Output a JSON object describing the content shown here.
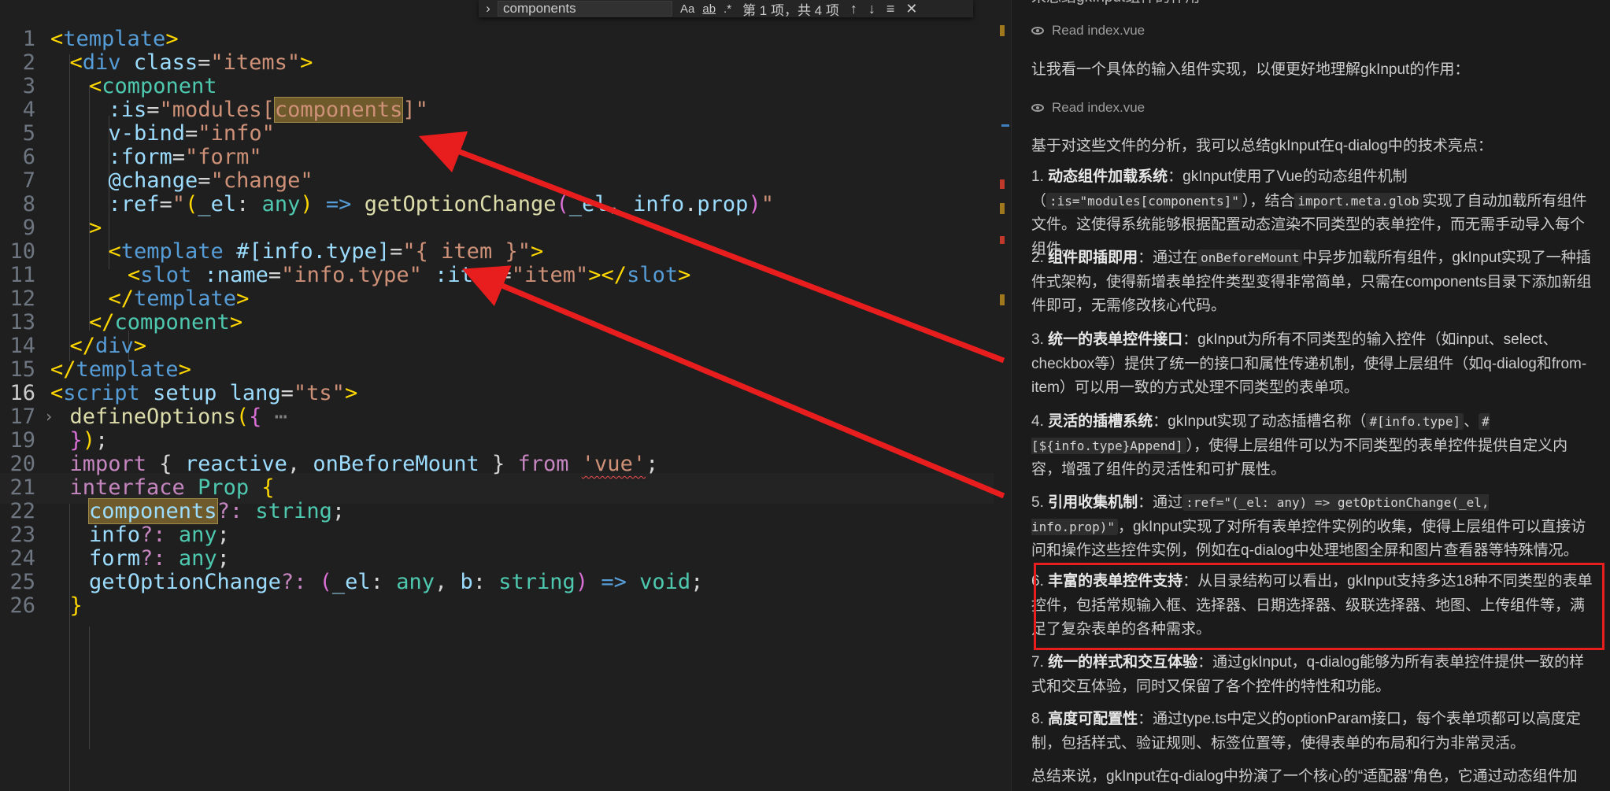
{
  "find_widget": {
    "query": "components",
    "match_case_label": "Aa",
    "whole_word_label": "ab",
    "regex_label": ".*",
    "result_count": "第 1 项，共 4 项",
    "prev_icon": "arrow-up-icon",
    "next_icon": "arrow-down-icon",
    "selection_icon": "find-in-selection-icon",
    "close_icon": "close-icon"
  },
  "editor": {
    "line_numbers": [
      "1",
      "2",
      "3",
      "4",
      "5",
      "6",
      "7",
      "8",
      "9",
      "10",
      "11",
      "12",
      "13",
      "14",
      "15",
      "16",
      "17",
      "19",
      "20",
      "21",
      "22",
      "23",
      "24",
      "25",
      "26"
    ],
    "current_line": "16",
    "lines": {
      "l1": [
        "<",
        "template",
        ">"
      ],
      "l2": [
        "<",
        "div",
        " class",
        "=",
        "\"items\"",
        ">"
      ],
      "l3": [
        "<",
        "component"
      ],
      "l4": [
        ":is",
        "=",
        "\"modules[",
        "components",
        "]\""
      ],
      "l5": [
        "v-bind",
        "=",
        "\"info\""
      ],
      "l6": [
        ":form",
        "=",
        "\"form\""
      ],
      "l7": [
        "@change",
        "=",
        "\"change\""
      ],
      "l8": [
        ":ref",
        "=",
        "\"",
        "(",
        "_el",
        ": ",
        "any",
        ")",
        " => ",
        "getOptionChange",
        "(",
        "_el",
        ", ",
        "info",
        ".",
        "prop",
        ")",
        "\""
      ],
      "l9": [
        ">"
      ],
      "l10": [
        "<",
        "template",
        " #[info.type]",
        "=",
        "\"{ item }\"",
        ">"
      ],
      "l11": [
        "<",
        "slot",
        " :name",
        "=",
        "\"info.type\"",
        " :item",
        "=",
        "\"item\"",
        "></",
        "slot",
        ">"
      ],
      "l12": [
        "</",
        "template",
        ">"
      ],
      "l13": [
        "</",
        "component",
        ">"
      ],
      "l14": [
        "</",
        "div",
        ">"
      ],
      "l15": [
        "</",
        "template",
        ">"
      ],
      "l16": [
        "<",
        "script",
        " setup",
        " lang",
        "=",
        "\"ts\"",
        ">"
      ],
      "l17": [
        "defineOptions",
        "(",
        "{",
        " ⋯"
      ],
      "l19": [
        "}",
        ")",
        ";"
      ],
      "l20": [
        "import",
        " { ",
        "reactive",
        ", ",
        "onBeforeMount",
        " } ",
        "from",
        " ",
        "'vue'",
        ";"
      ],
      "l21": [
        "interface",
        " ",
        "Prop",
        " ",
        "{"
      ],
      "l22": [
        "components",
        "?: ",
        "string",
        ";"
      ],
      "l23": [
        "info",
        "?: ",
        "any",
        ";"
      ],
      "l24": [
        "form",
        "?: ",
        "any",
        ";"
      ],
      "l25": [
        "getOptionChange",
        "?: ",
        "(",
        "_el",
        ": ",
        "any",
        ", ",
        "b",
        ": ",
        "string",
        ")",
        " => ",
        "void",
        ";"
      ],
      "l26": [
        "}"
      ]
    }
  },
  "chat": {
    "top_partial": "来总结gkInput组件的作用",
    "tool_read_1": "Read index.vue",
    "intro": "让我看一个具体的输入组件实现，以便更好地理解gkInput的作用：",
    "tool_read_2": "Read index.vue",
    "summary_intro": "基于对这些文件的分析，我可以总结gkInput在q-dialog中的技术亮点：",
    "items": [
      {
        "num": "1.",
        "title": "动态组件加载系统",
        "t1": "：gkInput使用了Vue的动态组件机制（",
        "c1": ":is=\"modules[components]\"",
        "t2": "），结合",
        "c2": "import.meta.glob",
        "t3": "实现了自动加载所有组件文件。这使得系统能够根据配置动态渲染不同类型的表单控件，而无需手动导入每个组件。"
      },
      {
        "num": "2.",
        "title": "组件即插即用",
        "t1": "：通过在",
        "c1": "onBeforeMount",
        "t2": "中异步加载所有组件，gkInput实现了一种插件式架构，使得新增表单控件类型变得非常简单，只需在components目录下添加新组件即可，无需修改核心代码。"
      },
      {
        "num": "3.",
        "title": "统一的表单控件接口",
        "t1": "：gkInput为所有不同类型的输入控件（如input、select、checkbox等）提供了统一的接口和属性传递机制，使得上层组件（如q-dialog和from-item）可以用一致的方式处理不同类型的表单项。"
      },
      {
        "num": "4.",
        "title": "灵活的插槽系统",
        "t1": "：gkInput实现了动态插槽名称（",
        "c1": "#[info.type]",
        "t2": "、",
        "c2": "#[${info.type}Append]",
        "t3": "），使得上层组件可以为不同类型的表单控件提供自定义内容，增强了组件的灵活性和可扩展性。"
      },
      {
        "num": "5.",
        "title": "引用收集机制",
        "t1": "：通过",
        "c1": ":ref=\"(_el: any) => getOptionChange(_el, info.prop)\"",
        "t2": "，gkInput实现了对所有表单控件实例的收集，使得上层组件可以直接访问和操作这些控件实例，例如在q-dialog中处理地图全屏和图片查看器等特殊情况。"
      },
      {
        "num": "6.",
        "title": "丰富的表单控件支持",
        "t1": "：从目录结构可以看出，gkInput支持多达18种不同类型的表单控件，包括常规输入框、选择器、日期选择器、级联选择器、地图、上传组件等，满足了复杂表单的各种需求。"
      },
      {
        "num": "7.",
        "title": "统一的样式和交互体验",
        "t1": "：通过gkInput，q-dialog能够为所有表单控件提供一致的样式和交互体验，同时又保留了各个控件的特性和功能。"
      },
      {
        "num": "8.",
        "title": "高度可配置性",
        "t1": "：通过type.ts中定义的optionParam接口，每个表单项都可以高度定制，包括样式、验证规则、标签位置等，使得表单的布局和行为非常灵活。"
      }
    ],
    "conclusion": "总结来说，gkInput在q-dialog中扮演了一个核心的“适配器”角色，它通过动态组件加"
  },
  "colors": {
    "annotation_red": "#e81e1e",
    "match_highlight": "#6e5a2a"
  }
}
